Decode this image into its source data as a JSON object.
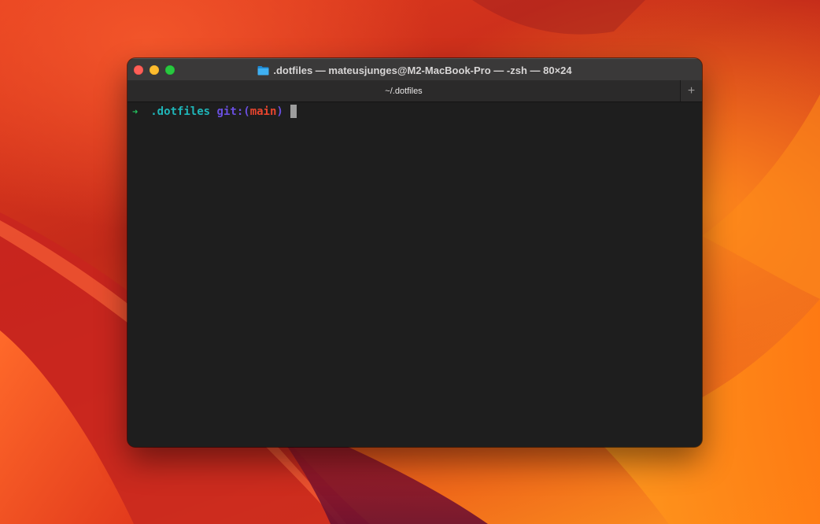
{
  "window": {
    "title": ".dotfiles — mateusjunges@M2-MacBook-Pro — -zsh — 80×24",
    "title_icon": "folder-icon",
    "traffic_lights": {
      "close": "#fe5f57",
      "minimize": "#febc2e",
      "maximize": "#28c840"
    }
  },
  "tabs": [
    {
      "label": "~/.dotfiles",
      "active": true
    }
  ],
  "new_tab_label": "+",
  "terminal": {
    "prompt": {
      "arrow": "➜",
      "directory": ".dotfiles",
      "git_prefix": "git:(",
      "branch": "main",
      "git_suffix": ")"
    },
    "colors": {
      "arrow": "#23c55e",
      "directory": "#1fb5b8",
      "git": "#6a4fe0",
      "branch": "#e8452e",
      "background": "#1e1e1e"
    }
  }
}
